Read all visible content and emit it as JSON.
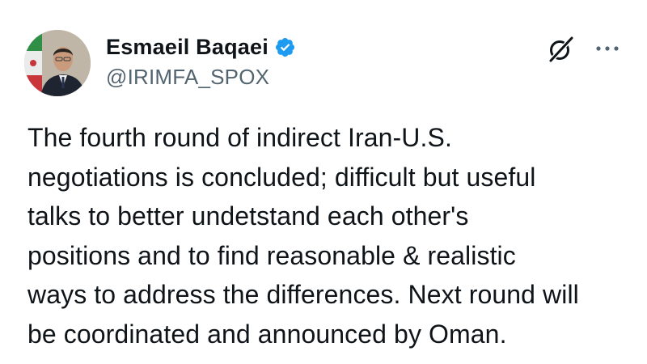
{
  "author": {
    "display_name": "Esmaeil Baqaei",
    "handle": "@IRIMFA_SPOX",
    "verified": true,
    "avatar_icon": "profile-photo"
  },
  "header_actions": {
    "grok_icon": "grok-icon",
    "more_icon": "more-options-icon"
  },
  "post": {
    "text": "The fourth round of indirect Iran-U.S.\nnegotiations is concluded; difficult but useful\ntalks to better undetstand each other's\npositions and to find reasonable & realistic\nways to address the differences. Next round will\nbe coordinated and announced by Oman."
  },
  "colors": {
    "text_primary": "#0f1419",
    "text_secondary": "#536471",
    "verified_blue": "#1d9bf0"
  }
}
